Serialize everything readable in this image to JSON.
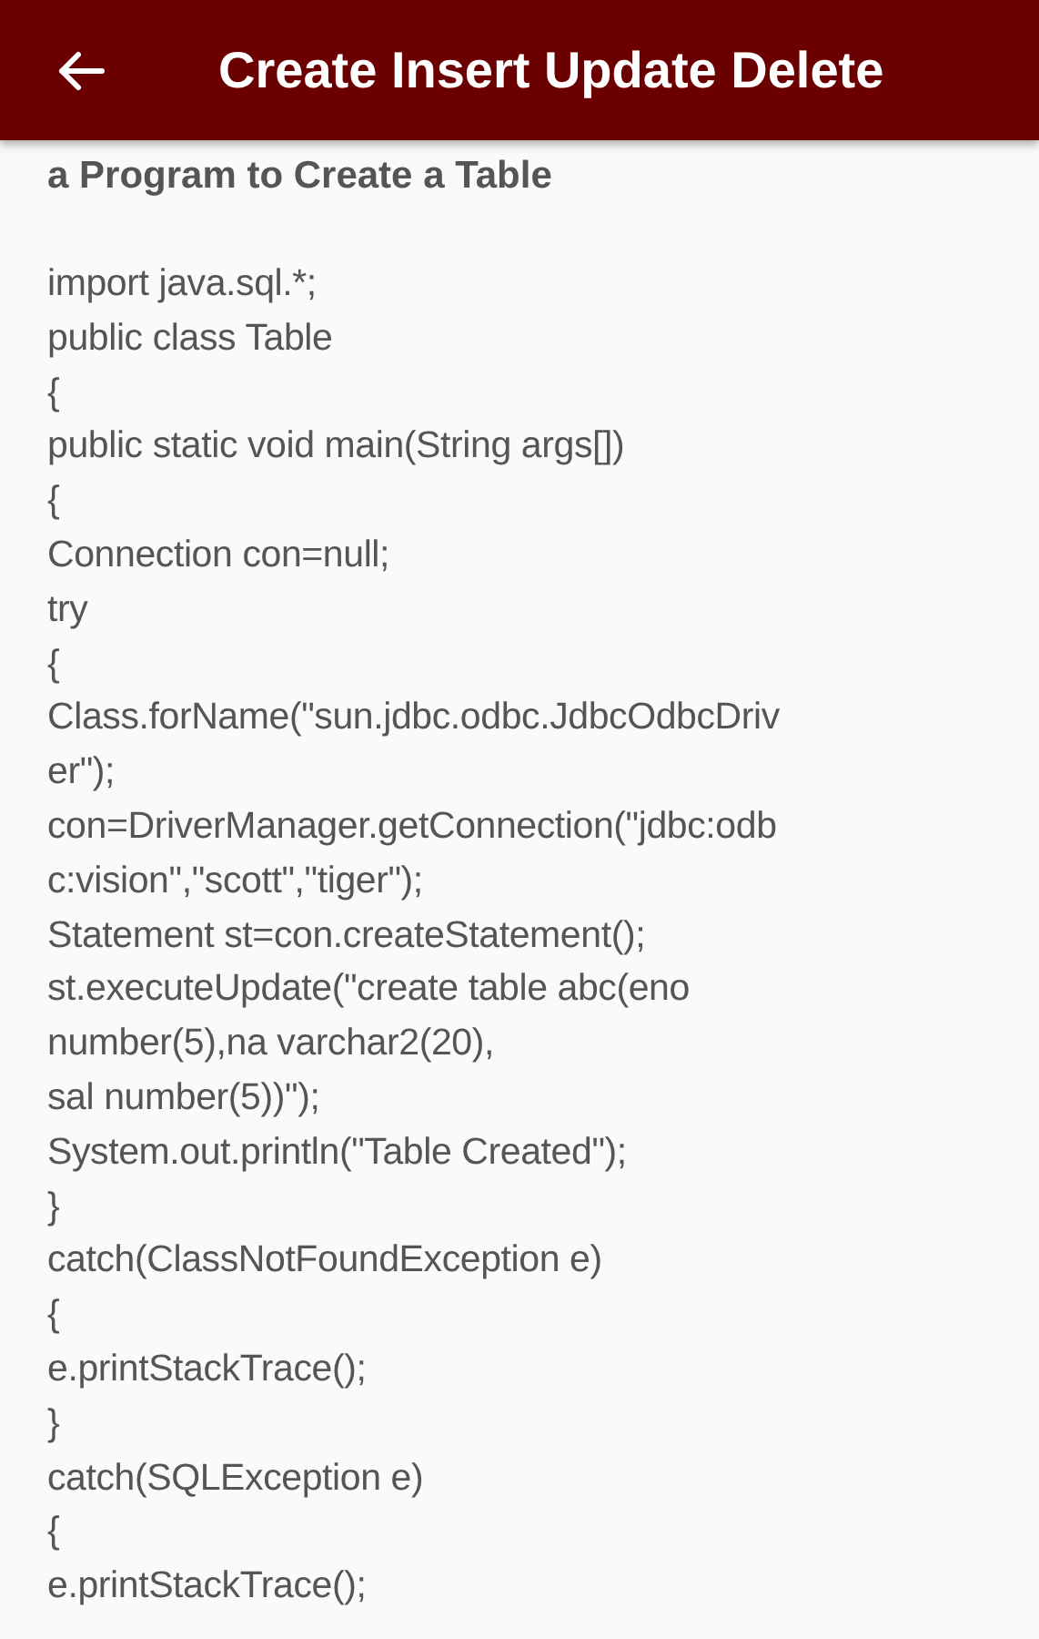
{
  "app_bar": {
    "title": "Create Insert Update Delete"
  },
  "heading": "a Program to Create a Table",
  "code_lines": [
    "import java.sql.*;",
    "public class Table",
    "{",
    "public static void main(String args[])",
    "{",
    "Connection con=null;",
    "try",
    "{",
    "Class.forName(\"sun.jdbc.odbc.JdbcOdbcDriv",
    "er\");",
    "con=DriverManager.getConnection(\"jdbc:odb",
    "c:vision\",\"scott\",\"tiger\");",
    "Statement st=con.createStatement();",
    "st.executeUpdate(\"create table abc(eno",
    "number(5),na varchar2(20),",
    "sal number(5))\");",
    "System.out.println(\"Table Created\");",
    "}",
    "catch(ClassNotFoundException e)",
    "{",
    "e.printStackTrace();",
    "}",
    "catch(SQLException e)",
    "{",
    "e.printStackTrace();"
  ]
}
